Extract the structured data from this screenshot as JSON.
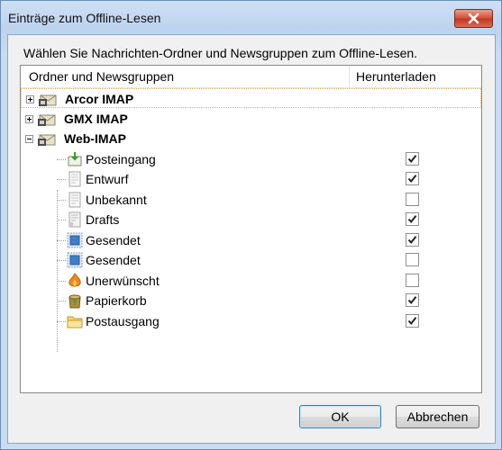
{
  "window": {
    "title": "Einträge zum Offline-Lesen",
    "instruction": "Wählen Sie Nachrichten-Ordner und Newsgruppen zum Offline-Lesen."
  },
  "columns": {
    "folders": "Ordner und Newsgruppen",
    "download": "Herunterladen"
  },
  "accounts": [
    {
      "name": "Arcor IMAP",
      "expanded": false
    },
    {
      "name": "GMX IMAP",
      "expanded": false
    },
    {
      "name": "Web-IMAP",
      "expanded": true
    }
  ],
  "folders": [
    {
      "name": "Posteingang",
      "icon": "inbox-icon",
      "checked": true
    },
    {
      "name": "Entwurf",
      "icon": "draft-icon",
      "checked": true
    },
    {
      "name": "Unbekannt",
      "icon": "document-icon",
      "checked": false
    },
    {
      "name": "Drafts",
      "icon": "drafts-icon",
      "checked": true
    },
    {
      "name": "Gesendet",
      "icon": "sent-icon",
      "checked": true
    },
    {
      "name": "Gesendet",
      "icon": "sent-icon",
      "checked": false
    },
    {
      "name": "Unerwünscht",
      "icon": "junk-icon",
      "checked": false
    },
    {
      "name": "Papierkorb",
      "icon": "trash-icon",
      "checked": true
    },
    {
      "name": "Postausgang",
      "icon": "outbox-icon",
      "checked": true
    }
  ],
  "buttons": {
    "ok": "OK",
    "cancel": "Abbrechen"
  }
}
